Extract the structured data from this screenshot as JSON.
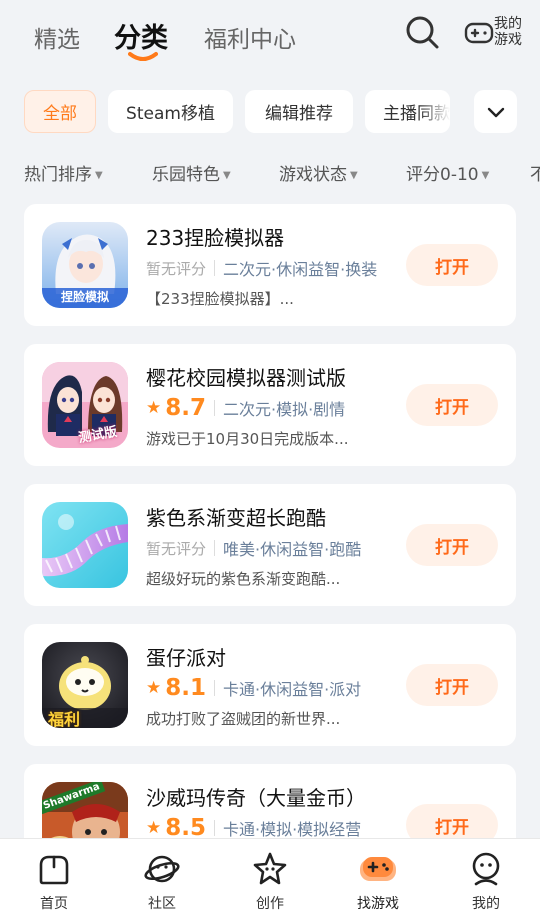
{
  "header": {
    "tabs": [
      {
        "label": "精选",
        "active": false
      },
      {
        "label": "分类",
        "active": true
      },
      {
        "label": "福利中心",
        "active": false
      }
    ],
    "search_icon": "search-icon",
    "my_games_label": "我的游戏",
    "accent_color": "#ff7a1a"
  },
  "categories": {
    "chips": [
      {
        "label": "全部",
        "active": true
      },
      {
        "label": "Steam移植",
        "active": false
      },
      {
        "label": "编辑推荐",
        "active": false
      },
      {
        "label": "主播同款",
        "active": false
      }
    ],
    "more_icon": "chevron-down-icon"
  },
  "filters": [
    {
      "label": "热门排序"
    },
    {
      "label": "乐园特色"
    },
    {
      "label": "游戏状态"
    },
    {
      "label": "评分0-10"
    },
    {
      "label": "不"
    }
  ],
  "games": [
    {
      "title": "233捏脸模拟器",
      "rating": null,
      "no_rating_label": "暂无评分",
      "tags": "二次元·休闲益智·换装",
      "description": "【233捏脸模拟器】...",
      "button": "打开",
      "icon": "game-icon-anime-girl"
    },
    {
      "title": "樱花校园模拟器测试版",
      "rating": "8.7",
      "no_rating_label": "",
      "tags": "二次元·模拟·剧情",
      "description": "游戏已于10月30日完成版本...",
      "button": "打开",
      "icon": "game-icon-sakura-school"
    },
    {
      "title": "紫色系渐变超长跑酷",
      "rating": null,
      "no_rating_label": "暂无评分",
      "tags": "唯美·休闲益智·跑酷",
      "description": "超级好玩的紫色系渐变跑酷...",
      "button": "打开",
      "icon": "game-icon-purple-track"
    },
    {
      "title": "蛋仔派对",
      "rating": "8.1",
      "no_rating_label": "",
      "tags": "卡通·休闲益智·派对",
      "description": "成功打败了盗贼团的新世界...",
      "button": "打开",
      "icon": "game-icon-eggy"
    },
    {
      "title": "沙威玛传奇（大量金币）",
      "rating": "8.5",
      "no_rating_label": "",
      "tags": "卡通·模拟·模拟经营",
      "description": "",
      "button": "打开",
      "icon": "game-icon-shawarma"
    }
  ],
  "icon_texts": {
    "g1": "捏脸模拟",
    "g2": "测试版",
    "g4": "福利",
    "g5": "Shawarma"
  },
  "bottom_nav": [
    {
      "label": "首页",
      "icon": "home-icon",
      "active": false
    },
    {
      "label": "社区",
      "icon": "planet-icon",
      "active": false
    },
    {
      "label": "创作",
      "icon": "star-create-icon",
      "active": false
    },
    {
      "label": "找游戏",
      "icon": "gamepad-icon",
      "active": true
    },
    {
      "label": "我的",
      "icon": "profile-icon",
      "active": false
    }
  ]
}
